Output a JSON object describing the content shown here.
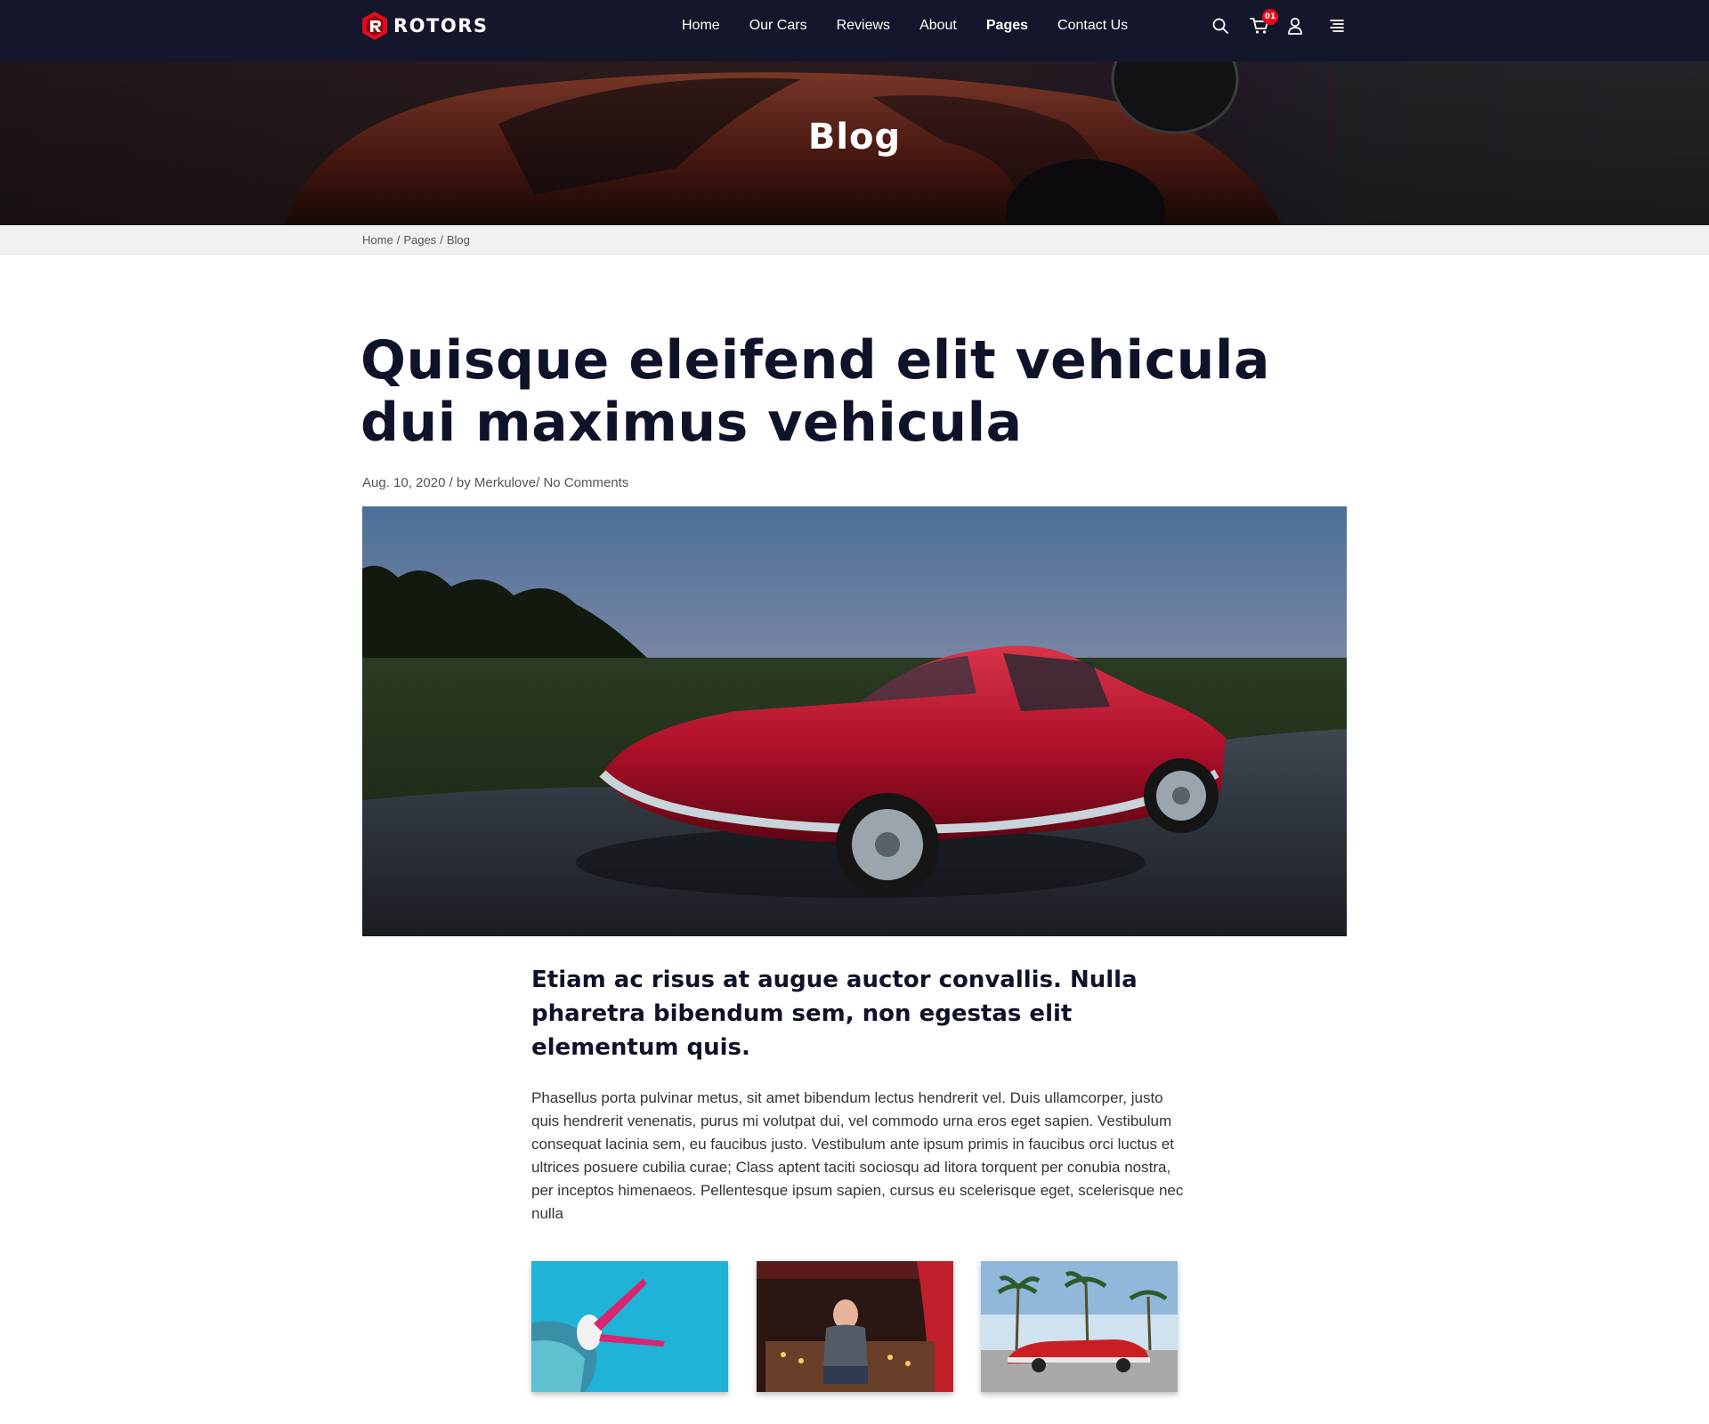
{
  "brand": {
    "name": "ROTORS",
    "accent": "#e20b1c",
    "dark": "#14172b"
  },
  "nav": {
    "items": [
      {
        "label": "Home"
      },
      {
        "label": "Our Cars"
      },
      {
        "label": "Reviews"
      },
      {
        "label": "About"
      },
      {
        "label": "Pages",
        "active": true
      },
      {
        "label": "Contact Us"
      }
    ]
  },
  "tools": {
    "search_icon": "search-icon",
    "cart_icon": "cart-icon",
    "cart_count": "01",
    "user_icon": "user-icon",
    "menu_icon": "menu-icon"
  },
  "hero": {
    "title": "Blog"
  },
  "breadcrumb": {
    "home": "Home",
    "pages": "Pages",
    "current": "Blog",
    "sep": "/"
  },
  "post": {
    "title": "Quisque eleifend elit vehicula dui maximus vehicula",
    "meta": "Aug. 10, 2020 / by Merkulove/ No Comments",
    "lead": "Etiam ac risus at augue auctor convallis. Nulla pharetra bibendum sem, non egestas elit elementum quis.",
    "body": "Phasellus porta pulvinar metus, sit amet bibendum lectus hendrerit vel. Duis ullamcorper, justo quis hendrerit venenatis, purus mi volutpat dui, vel commodo urna eros eget sapien. Vestibulum consequat lacinia sem, eu faucibus justo. Vestibulum ante ipsum primis in faucibus orci luctus et ultrices posuere cubilia curae; Class aptent taciti sociosqu ad litora torquent per conubia nostra, per inceptos himenaeos. Pellentesque ipsum sapien, cursus eu scelerisque eget, scelerisque nec nulla"
  }
}
